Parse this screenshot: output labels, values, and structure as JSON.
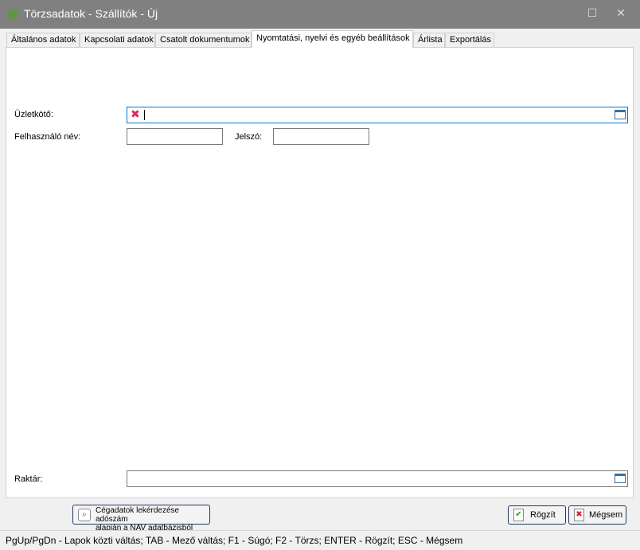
{
  "window": {
    "title": "Törzsadatok - Szállítók - Új",
    "maximize": "☐",
    "close": "✕"
  },
  "tabs": [
    "Általános adatok",
    "Kapcsolati adatok",
    "Csatolt dokumentumok",
    "Nyomtatási, nyelvi és egyéb beállítások",
    "Árlista",
    "Exportálás"
  ],
  "active_tab": 3,
  "form": {
    "uzletkoto_label": "Üzletkötő:",
    "uzletkoto_value": "",
    "felhasznalo_label": "Felhasználó név:",
    "felhasznalo_value": "",
    "jelszo_label": "Jelszó:",
    "jelszo_value": "",
    "raktar_label": "Raktár:",
    "raktar_value": ""
  },
  "buttons": {
    "nav_line1": "Cégadatok lekérdezése adószám",
    "nav_line2": "alapján a NAV adatbázisból",
    "save": "Rögzít",
    "cancel": "Mégsem"
  },
  "status": "PgUp/PgDn - Lapok közti váltás; TAB - Mező váltás; F1 - Súgó; F2 - Törzs; ENTER - Rögzít; ESC - Mégsem"
}
